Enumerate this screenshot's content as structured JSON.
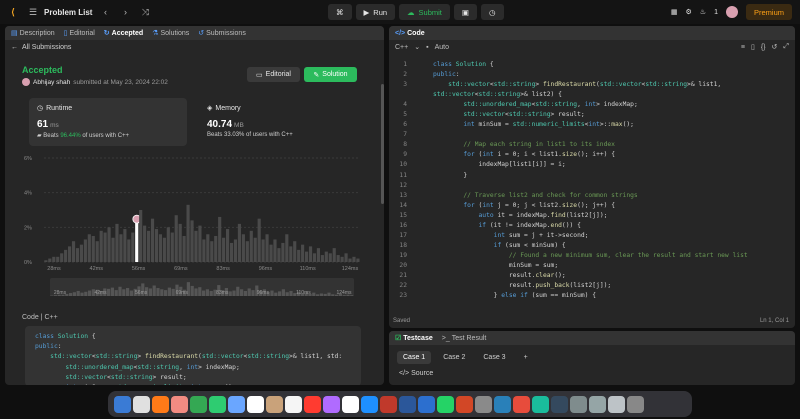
{
  "topbar": {
    "title": "Problem List",
    "run": "Run",
    "submit": "Submit",
    "streak": "1",
    "premium": "Premium"
  },
  "left_tabs": [
    {
      "label": "Description"
    },
    {
      "label": "Editorial"
    },
    {
      "label": "Accepted"
    },
    {
      "label": "Solutions"
    },
    {
      "label": "Submissions"
    }
  ],
  "subbar": {
    "back": "All Submissions"
  },
  "result": {
    "status": "Accepted",
    "user": "Abhijay shah",
    "submitted": "submitted at May 23, 2024 22:02"
  },
  "buttons": {
    "editorial": "Editorial",
    "solution": "Solution"
  },
  "runtime": {
    "label": "Runtime",
    "value": "61",
    "unit": "ms",
    "beats_prefix": "Beats",
    "beats": "96.44%",
    "beats_suffix": "of users with C++"
  },
  "memory": {
    "label": "Memory",
    "value": "40.74",
    "unit": "MB",
    "beats_prefix": "Beats",
    "beats": "33.03%",
    "beats_suffix": "of users with C++"
  },
  "chart_data": {
    "type": "bar",
    "y_ticks": [
      "6%",
      "4%",
      "2%",
      "0%"
    ],
    "x_ticks": [
      "28ms",
      "42ms",
      "56ms",
      "69ms",
      "83ms",
      "96ms",
      "110ms",
      "124ms"
    ],
    "mini_ticks": [
      "28ms",
      "42ms",
      "56ms",
      "69ms",
      "83ms",
      "96ms",
      "110ms",
      "124ms"
    ],
    "values": [
      0.1,
      0.2,
      0.3,
      0.3,
      0.5,
      0.7,
      0.9,
      1.2,
      0.8,
      1.0,
      1.3,
      1.6,
      1.5,
      1.2,
      1.8,
      1.7,
      2.0,
      1.4,
      2.2,
      1.6,
      1.9,
      1.3,
      1.7,
      2.3,
      3.0,
      2.1,
      1.8,
      2.5,
      1.9,
      1.6,
      1.4,
      2.0,
      1.7,
      2.7,
      2.2,
      1.5,
      3.3,
      2.4,
      1.8,
      2.1,
      1.3,
      1.6,
      1.2,
      1.5,
      2.6,
      1.4,
      1.9,
      1.1,
      1.3,
      2.2,
      1.6,
      1.2,
      1.8,
      1.4,
      2.5,
      1.3,
      1.6,
      1.0,
      1.3,
      0.8,
      1.1,
      1.6,
      0.9,
      1.2,
      0.7,
      1.0,
      0.6,
      0.9,
      0.5,
      0.8,
      0.4,
      0.6,
      0.5,
      0.8,
      0.4,
      0.3,
      0.5,
      0.2,
      0.3,
      0.2
    ],
    "ylim": [
      0,
      6
    ],
    "highlight_index": 23
  },
  "code_section": {
    "label": "Code",
    "lang": "C++"
  },
  "left_code": [
    "class Solution {",
    "public:",
    "    std::vector<std::string> findRestaurant(std::vector<std::string>& list1, std:",
    "        std::unordered_map<std::string, int> indexMap;",
    "        std::vector<std::string> result;",
    "        int minSum = std::numeric_limits<int>::max();",
    "",
    "        // Map each string in list1 to its index"
  ],
  "editor": {
    "title": "Code",
    "lang": "C++",
    "mode": "Auto",
    "saved": "Saved",
    "position": "Ln 1, Col 1",
    "lines": [
      "class Solution {",
      "public:",
      "    std::vector<std::string> findRestaurant(std::vector<std::string>& list1,",
      "std::vector<std::string>& list2) {",
      "        std::unordered_map<std::string, int> indexMap;",
      "        std::vector<std::string> result;",
      "        int minSum = std::numeric_limits<int>::max();",
      "",
      "        // Map each string in list1 to its index",
      "        for (int i = 0; i < list1.size(); i++) {",
      "            indexMap[list1[i]] = i;",
      "        }",
      "",
      "        // Traverse list2 and check for common strings",
      "        for (int j = 0; j < list2.size(); j++) {",
      "            auto it = indexMap.find(list2[j]);",
      "            if (it != indexMap.end()) {",
      "                int sum = j + it->second;",
      "                if (sum < minSum) {",
      "                    // Found a new minimum sum, clear the result and start new list",
      "                    minSum = sum;",
      "                    result.clear();",
      "                    result.push_back(list2[j]);",
      "                } else if (sum == minSum) {"
    ],
    "numbers": [
      "1",
      "2",
      "3",
      "",
      "4",
      "5",
      "6",
      "7",
      "8",
      "9",
      "10",
      "11",
      "12",
      "13",
      "14",
      "15",
      "16",
      "17",
      "18",
      "19",
      "20",
      "21",
      "22",
      "23"
    ]
  },
  "testcase": {
    "tab1": "Testcase",
    "tab2": "Test Result",
    "cases": [
      "Case 1",
      "Case 2",
      "Case 3"
    ],
    "source": "Source"
  }
}
